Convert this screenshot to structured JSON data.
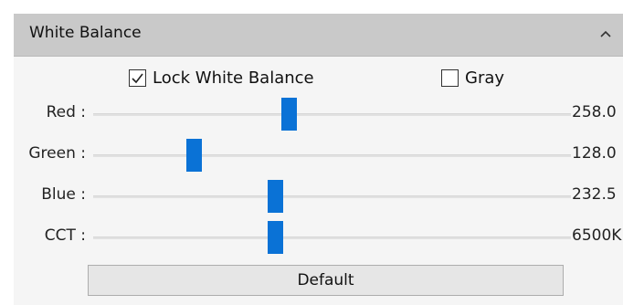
{
  "panel": {
    "title": "White Balance",
    "collapse_icon": "chevron-up-icon"
  },
  "options": {
    "lock_white_balance": {
      "label": "Lock White Balance",
      "checked": true
    },
    "gray": {
      "label": "Gray",
      "checked": false
    }
  },
  "sliders": [
    {
      "id": "red",
      "label": "Red :",
      "value": "258.0",
      "level": 0.41
    },
    {
      "id": "green",
      "label": "Green :",
      "value": "128.0",
      "level": 0.21
    },
    {
      "id": "blue",
      "label": "Blue :",
      "value": "232.5",
      "level": 0.38
    },
    {
      "id": "cct",
      "label": "CCT :",
      "value": "6500K",
      "level": 0.38
    }
  ],
  "default_button": {
    "label": "Default"
  },
  "colors": {
    "header_bg": "#c9c9c9",
    "panel_bg": "#f5f5f5",
    "thumb": "#0a72d6"
  }
}
